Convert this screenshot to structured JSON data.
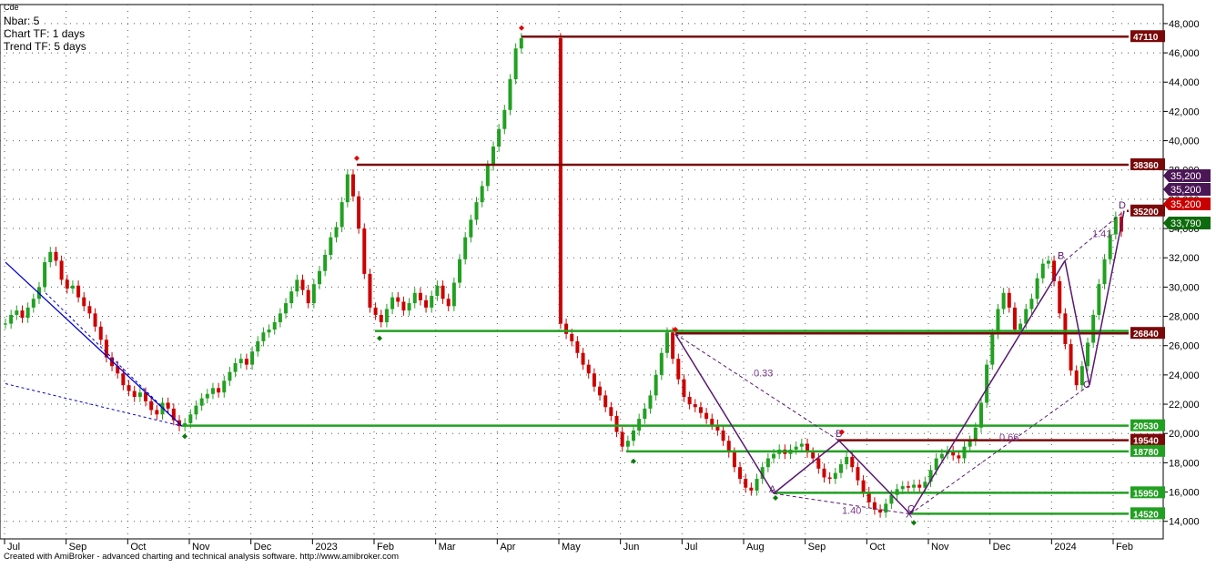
{
  "header": {
    "symbol_tag": "Cde",
    "nbar_label": "Nbar: 5",
    "chart_tf_label": "Chart TF: 1 days",
    "trend_tf_label": "Trend TF: 5 days"
  },
  "footer": {
    "credit": "Created with AmiBroker - advanced charting and technical analysis software. http://www.amibroker.com"
  },
  "chart_data": {
    "type": "candlestick",
    "y_range": [
      12800,
      49300
    ],
    "y_ticks": [
      "14,000",
      "16,000",
      "18,000",
      "20,000",
      "22,000",
      "24,000",
      "26,000",
      "28,000",
      "30,000",
      "32,000",
      "34,000",
      "36,000",
      "38,000",
      "40,000",
      "42,000",
      "44,000",
      "46,000",
      "48,000"
    ],
    "x_labels": [
      "Jul",
      "Sep",
      "Oct",
      "Nov",
      "Dec",
      "2023",
      "Feb",
      "Mar",
      "Apr",
      "May",
      "Jun",
      "Jul",
      "Aug",
      "Sep",
      "Oct",
      "Nov",
      "Dec",
      "2024",
      "Feb"
    ],
    "grid": true,
    "colors": {
      "up": "#22a022",
      "down": "#cc0000",
      "support": "#22a022",
      "resistance": "#7a0a0a",
      "pattern": "#5a1870",
      "trendline": "#0000cc"
    },
    "levels": [
      {
        "value": 47110,
        "label": "47110",
        "kind": "resistance"
      },
      {
        "value": 38360,
        "label": "38360",
        "kind": "resistance"
      },
      {
        "value": 35200,
        "label": "35200",
        "kind": "resistance"
      },
      {
        "value": 26840,
        "label": "26840",
        "kind": "resistance"
      },
      {
        "value": 27000,
        "label": "",
        "kind": "support"
      },
      {
        "value": 20530,
        "label": "20530",
        "kind": "support"
      },
      {
        "value": 19540,
        "label": "19540",
        "kind": "resistance"
      },
      {
        "value": 18780,
        "label": "18780",
        "kind": "support"
      },
      {
        "value": 15950,
        "label": "15950",
        "kind": "support"
      },
      {
        "value": 14520,
        "label": "14520",
        "kind": "support"
      }
    ],
    "price_tags": [
      {
        "value": 35200,
        "label": "35,200",
        "color": "#4b1656"
      },
      {
        "value": 35200,
        "label": "35,200",
        "color": "#4b1656"
      },
      {
        "value": 35200,
        "label": "35,200",
        "color": "#c80000"
      },
      {
        "value": 33790,
        "label": "33,790",
        "color": "#0d6b0d"
      }
    ],
    "harmonic": {
      "points": [
        {
          "name": "X",
          "date_index": 0,
          "value": 14600
        },
        {
          "name": "A",
          "date_index": 1,
          "value": 15900
        },
        {
          "name": "B",
          "date_index": 2,
          "value": 19500
        },
        {
          "name": "C",
          "date_index": 3,
          "value": 14500
        },
        {
          "name": "B",
          "date_index": 4,
          "value": 31800
        },
        {
          "name": "C",
          "date_index": 5,
          "value": 23300
        },
        {
          "name": "D",
          "date_index": 6,
          "value": 35200
        }
      ],
      "ratios": [
        "0.33",
        "1.40",
        "0.66",
        "1.41"
      ]
    },
    "series": [
      {
        "name": "",
        "values": [
          27500,
          28100,
          28400,
          27900,
          28600,
          29200,
          30000,
          31700,
          32400,
          31800,
          30500,
          29900,
          30100,
          29300,
          28700,
          28200,
          27300,
          26400,
          25200,
          24600,
          24100,
          23300,
          22900,
          22500,
          22800,
          22200,
          21600,
          21300,
          22100,
          21700,
          20900,
          20500,
          20700,
          21300,
          21900,
          22400,
          22700,
          23100,
          22800,
          23600,
          24200,
          24800,
          25100,
          24700,
          25600,
          26300,
          26900,
          27100,
          27600,
          28200,
          28900,
          29700,
          30500,
          29800,
          28900,
          30200,
          31100,
          32200,
          33400,
          34100,
          35800,
          37700,
          36200,
          34000,
          30900,
          28600,
          28100,
          27600,
          28500,
          29300,
          29000,
          28400,
          28900,
          29600,
          29100,
          28600,
          29400,
          30100,
          29200,
          28700,
          30300,
          31900,
          33400,
          34600,
          35800,
          36900,
          38300,
          39600,
          40800,
          42100,
          44200,
          46300,
          47000,
          null,
          null,
          null,
          null,
          null,
          null,
          27500,
          26800,
          26300,
          25500,
          24700,
          24100,
          23200,
          22600,
          21800,
          21200,
          20100,
          19100,
          19500,
          20200,
          21000,
          21700,
          22600,
          24000,
          25500,
          26900,
          25100,
          23700,
          22500,
          22000,
          21800,
          21400,
          21000,
          20600,
          20200,
          19500,
          18700,
          17700,
          16900,
          16300,
          16100,
          16900,
          17700,
          18300,
          18600,
          18900,
          18600,
          18900,
          19100,
          19300,
          18700,
          18300,
          17600,
          17000,
          16900,
          17300,
          17900,
          18400,
          17700,
          16800,
          16000,
          15300,
          14800,
          14600,
          15200,
          15800,
          16200,
          16400,
          16300,
          16500,
          16300,
          16700,
          17500,
          18300,
          18600,
          18800,
          18500,
          18300,
          19100,
          19500,
          20400,
          22100,
          24700,
          26800,
          28500,
          29600,
          28600,
          27100,
          27500,
          28500,
          29200,
          30600,
          31600,
          31800,
          30400,
          28200,
          26100,
          24300,
          23300,
          24600,
          26200,
          28100,
          30200,
          31900,
          33600,
          34800,
          33790
        ]
      }
    ]
  }
}
